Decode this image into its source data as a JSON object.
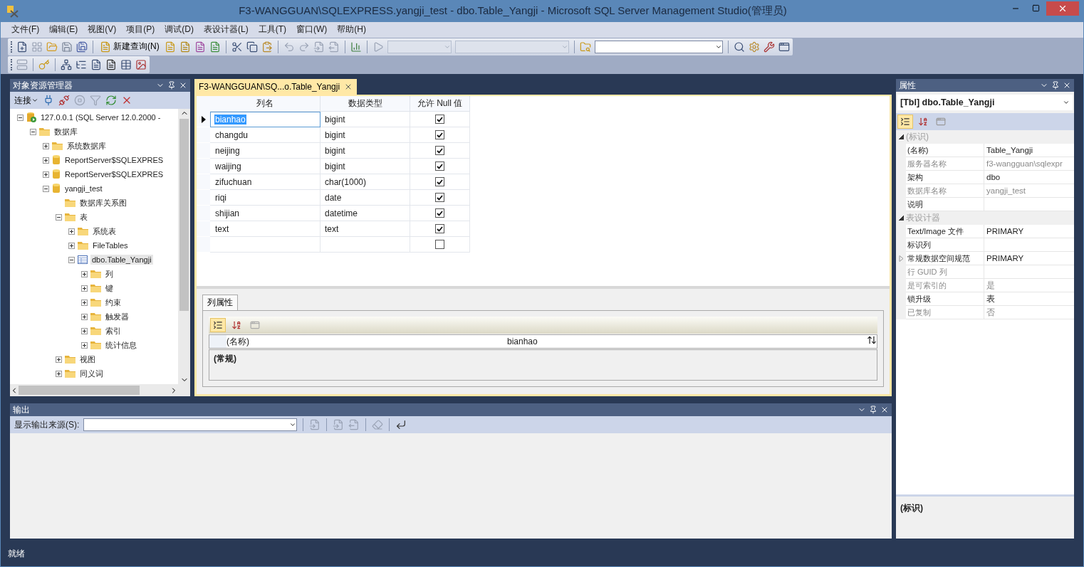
{
  "window": {
    "title": "F3-WANGGUAN\\SQLEXPRESS.yangji_test - dbo.Table_Yangji - Microsoft SQL Server Management Studio(管理员)"
  },
  "menu": [
    "文件(F)",
    "编辑(E)",
    "视图(V)",
    "项目(P)",
    "调试(D)",
    "表设计器(L)",
    "工具(T)",
    "窗口(W)",
    "帮助(H)"
  ],
  "toolbar": {
    "new_query": "新建查询(N)"
  },
  "object_explorer": {
    "title": "对象资源管理器",
    "connect": "连接",
    "tree": [
      {
        "label": "127.0.0.1 (SQL Server 12.0.2000 -",
        "kind": "server",
        "expanded": true,
        "selected": false,
        "children": [
          {
            "label": "数据库",
            "kind": "folder",
            "expanded": true,
            "selected": false,
            "children": [
              {
                "label": "系统数据库",
                "kind": "folder",
                "expanded": false,
                "selected": false
              },
              {
                "label": "ReportServer$SQLEXPRES",
                "kind": "database",
                "expanded": false,
                "selected": false
              },
              {
                "label": "ReportServer$SQLEXPRES",
                "kind": "database",
                "expanded": false,
                "selected": false
              },
              {
                "label": "yangji_test",
                "kind": "database",
                "expanded": true,
                "selected": false,
                "children": [
                  {
                    "label": "数据库关系图",
                    "kind": "folder",
                    "selected": false
                  },
                  {
                    "label": "表",
                    "kind": "folder",
                    "expanded": true,
                    "selected": false,
                    "children": [
                      {
                        "label": "系统表",
                        "kind": "folder",
                        "expanded": false,
                        "selected": false
                      },
                      {
                        "label": "FileTables",
                        "kind": "folder",
                        "expanded": false,
                        "selected": false
                      },
                      {
                        "label": "dbo.Table_Yangji",
                        "kind": "table",
                        "expanded": true,
                        "selected": true,
                        "children": [
                          {
                            "label": "列",
                            "kind": "folder",
                            "expanded": false,
                            "selected": false
                          },
                          {
                            "label": "键",
                            "kind": "folder",
                            "expanded": false,
                            "selected": false
                          },
                          {
                            "label": "约束",
                            "kind": "folder",
                            "expanded": false,
                            "selected": false
                          },
                          {
                            "label": "触发器",
                            "kind": "folder",
                            "expanded": false,
                            "selected": false
                          },
                          {
                            "label": "索引",
                            "kind": "folder",
                            "expanded": false,
                            "selected": false
                          },
                          {
                            "label": "统计信息",
                            "kind": "folder",
                            "expanded": false,
                            "selected": false
                          }
                        ]
                      }
                    ]
                  },
                  {
                    "label": "视图",
                    "kind": "folder",
                    "expanded": false,
                    "selected": false
                  },
                  {
                    "label": "同义词",
                    "kind": "folder",
                    "expanded": false,
                    "selected": false
                  }
                ]
              }
            ]
          }
        ]
      }
    ]
  },
  "document": {
    "tab": {
      "label": "F3-WANGGUAN\\SQ...o.Table_Yangji",
      "selected": true
    },
    "columns": [
      "列名",
      "数据类型",
      "允许 Null 值"
    ],
    "rows": [
      {
        "name": "bianhao",
        "type": "bigint",
        "allow_null": true,
        "selected": true
      },
      {
        "name": "changdu",
        "type": "bigint",
        "allow_null": true,
        "selected": false
      },
      {
        "name": "neijing",
        "type": "bigint",
        "allow_null": true,
        "selected": false
      },
      {
        "name": "waijing",
        "type": "bigint",
        "allow_null": true,
        "selected": false
      },
      {
        "name": "zifuchuan",
        "type": "char(1000)",
        "allow_null": true,
        "selected": false
      },
      {
        "name": "riqi",
        "type": "date",
        "allow_null": true,
        "selected": false
      },
      {
        "name": "shijian",
        "type": "datetime",
        "allow_null": true,
        "selected": false
      },
      {
        "name": "text",
        "type": "text",
        "allow_null": true,
        "selected": false
      },
      {
        "allow_null": false,
        "selected": false
      }
    ]
  },
  "column_properties": {
    "tab": "列属性",
    "rows": [
      {
        "name": "(名称)",
        "value": "bianhao"
      }
    ],
    "description": "(常规)"
  },
  "properties": {
    "title": "属性",
    "object": "[Tbl] dbo.Table_Yangji",
    "categories": [
      {
        "name": "(标识)",
        "expanded": true,
        "items": [
          {
            "name": "(名称)",
            "value": "Table_Yangji",
            "disabled": false
          },
          {
            "name": "服务器名称",
            "value": "f3-wangguan\\sqlexpr",
            "disabled": true
          },
          {
            "name": "架构",
            "value": "dbo",
            "disabled": false
          },
          {
            "name": "数据库名称",
            "value": "yangji_test",
            "disabled": true
          },
          {
            "name": "说明",
            "disabled": false
          }
        ]
      },
      {
        "name": "表设计器",
        "expanded": true,
        "items": [
          {
            "name": "Text/Image 文件",
            "value": "PRIMARY",
            "disabled": false
          },
          {
            "name": "标识列",
            "disabled": false
          },
          {
            "name": "常规数据空间规范",
            "value": "PRIMARY",
            "disabled": false,
            "expanded": false
          },
          {
            "name": "行 GUID 列",
            "disabled": true
          },
          {
            "name": "是可索引的",
            "value": "是",
            "disabled": true
          },
          {
            "name": "锁升级",
            "value": "表",
            "disabled": false
          },
          {
            "name": "已复制",
            "value": "否",
            "disabled": true
          }
        ]
      }
    ],
    "description": "(标识)"
  },
  "output": {
    "title": "输出",
    "source_label": "显示输出来源(S):"
  },
  "status_bar": "就绪"
}
